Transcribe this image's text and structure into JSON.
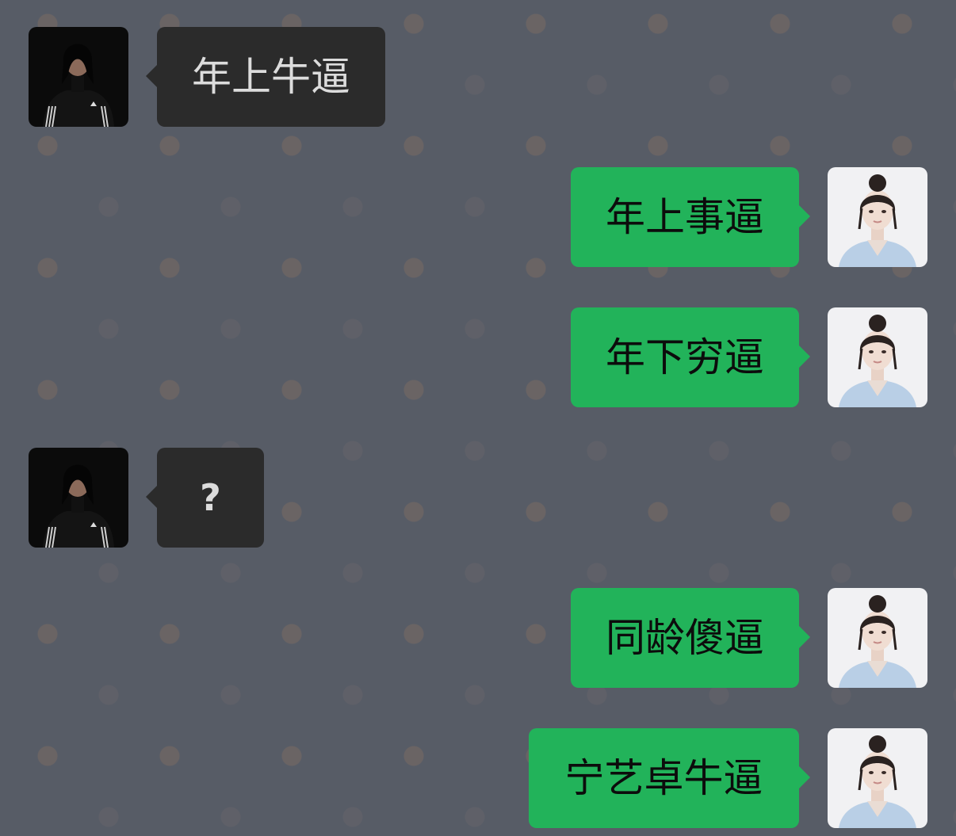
{
  "messages": [
    {
      "side": "in",
      "text": "年上牛逼"
    },
    {
      "side": "out",
      "text": "年上事逼"
    },
    {
      "side": "out",
      "text": "年下穷逼"
    },
    {
      "side": "in",
      "text": "?"
    },
    {
      "side": "out",
      "text": "同龄傻逼"
    },
    {
      "side": "out",
      "text": "宁艺卓牛逼"
    }
  ],
  "colors": {
    "background": "#575c66",
    "incoming_bubble": "#2b2b2b",
    "outgoing_bubble": "#22b35a"
  },
  "icons": {
    "incoming_avatar": "avatar-photo-dark",
    "outgoing_avatar": "avatar-photo-light"
  }
}
